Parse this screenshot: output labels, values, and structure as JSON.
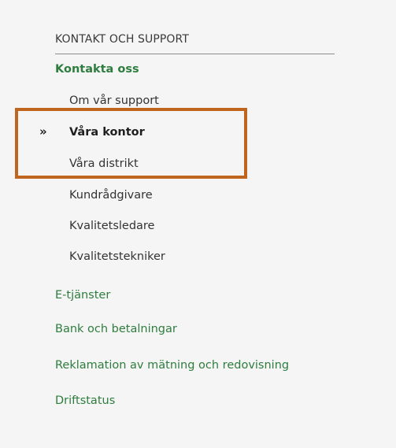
{
  "sidebar": {
    "section_title": "KONTAKT OCH SUPPORT",
    "group_title": "Kontakta oss",
    "sub_items": [
      {
        "label": "Om vår support",
        "active": false
      },
      {
        "label": "Våra kontor",
        "active": true
      },
      {
        "label": "Våra distrikt",
        "active": false
      },
      {
        "label": "Kundrådgivare",
        "active": false
      },
      {
        "label": "Kvalitetsledare",
        "active": false
      },
      {
        "label": "Kvalitetstekniker",
        "active": false
      }
    ],
    "links": [
      {
        "label": "E-tjänster"
      },
      {
        "label": "Bank och betalningar"
      },
      {
        "label": "Reklamation av mätning och redovisning"
      },
      {
        "label": "Driftstatus"
      }
    ],
    "active_marker": "»"
  },
  "colors": {
    "link_green": "#2e7d3e",
    "highlight": "#c0651e",
    "background": "#f5f5f5"
  }
}
